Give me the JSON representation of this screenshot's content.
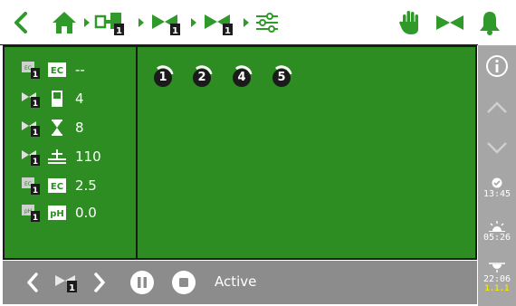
{
  "colors": {
    "accent_green": "#2f9a2a",
    "panel_green": "#2d8c22",
    "sidebar_gray": "#a6a6a6",
    "bottombar_gray": "#8c8c8c",
    "version_yellow": "#f2e600"
  },
  "topbar": {
    "icons": [
      "back-icon",
      "home-icon",
      "dosing-unit-icon",
      "valve-icon",
      "valve-icon",
      "settings-sliders-icon",
      "manual-hand-icon",
      "valve-icon",
      "alarm-bell-icon"
    ],
    "device_badge": "1"
  },
  "left_panel": {
    "rows": [
      {
        "device_icon": "ec-sensor-icon",
        "indicator_icon": "ec-icon",
        "indicator_text": "EC",
        "value": "--"
      },
      {
        "device_icon": "valve-icon",
        "indicator_icon": "level-icon",
        "indicator_text": "",
        "value": "4"
      },
      {
        "device_icon": "valve-icon",
        "indicator_icon": "hourglass-icon",
        "indicator_text": "",
        "value": "8"
      },
      {
        "device_icon": "valve-icon",
        "indicator_icon": "flow-icon",
        "indicator_text": "",
        "value": "110"
      },
      {
        "device_icon": "ec-sensor-icon",
        "indicator_icon": "ec-icon",
        "indicator_text": "EC",
        "value": "2.5"
      },
      {
        "device_icon": "ph-sensor-icon",
        "indicator_icon": "ph-icon",
        "indicator_text": "pH",
        "value": "0.0"
      }
    ],
    "badge": "1"
  },
  "steps": [
    "1",
    "2",
    "4",
    "5"
  ],
  "sidebar": {
    "info_icon": "info-icon",
    "up_icon": "chevron-up-icon",
    "down_icon": "chevron-down-icon",
    "times": [
      {
        "icon": "clock-check-icon",
        "time": "13:45"
      },
      {
        "icon": "sunrise-icon",
        "time": "05:26"
      },
      {
        "icon": "sunset-icon",
        "time": "22:06"
      }
    ],
    "version": "1.1.1"
  },
  "bottombar": {
    "status": "Active",
    "device_badge": "1"
  }
}
